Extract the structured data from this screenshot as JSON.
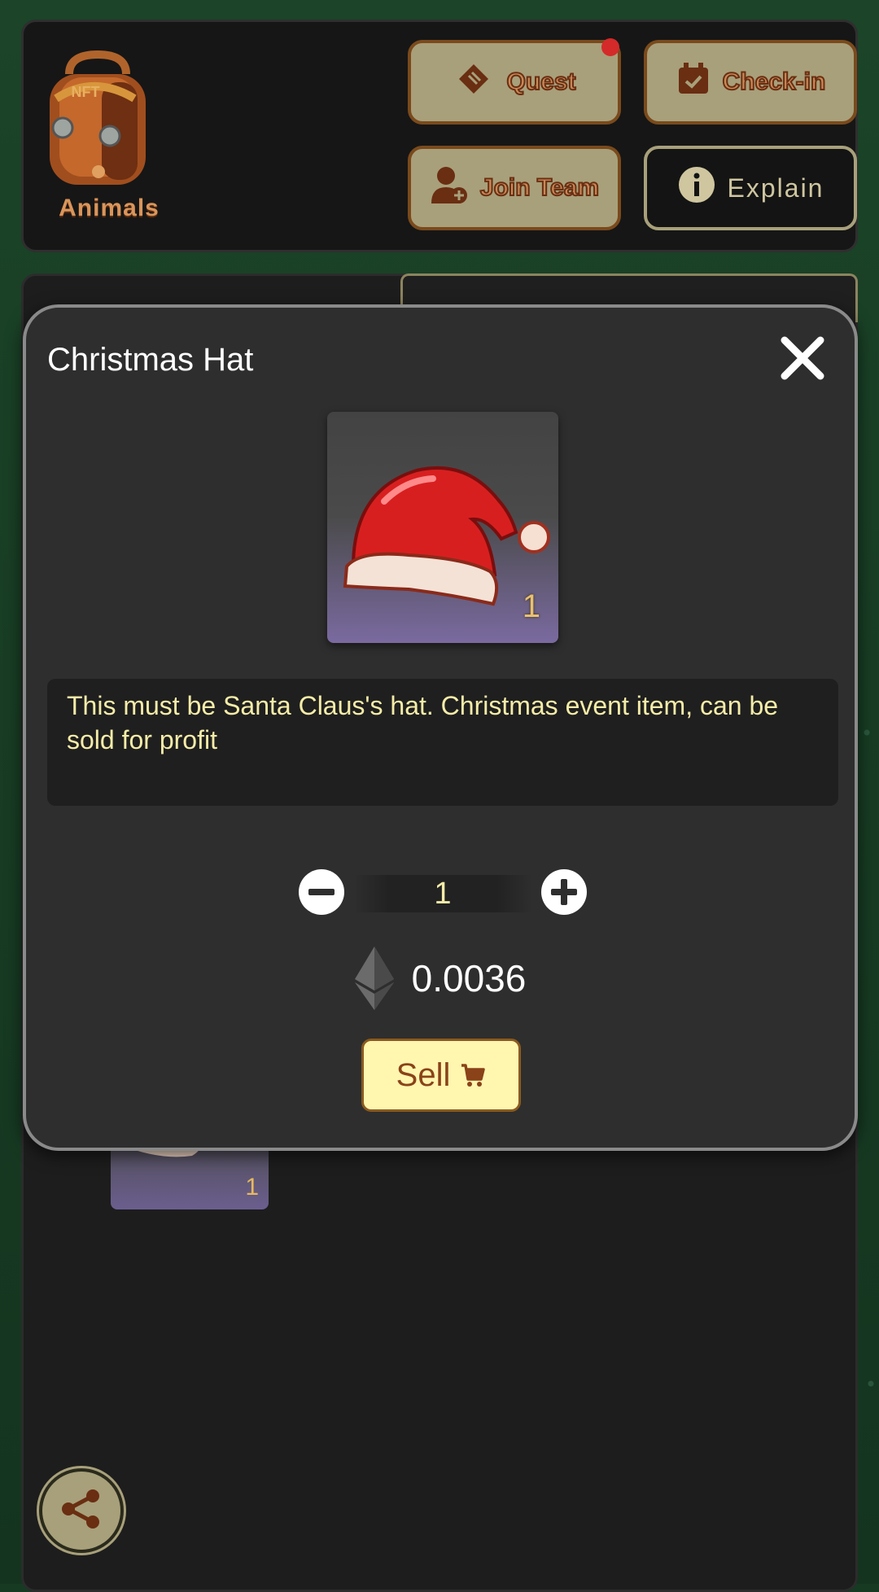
{
  "header": {
    "backpack_label": "Animals",
    "backpack_badge": "NFT",
    "quest_label": "Quest",
    "checkin_label": "Check-in",
    "join_team_label": "Join Team",
    "explain_label": "Explain"
  },
  "modal": {
    "title": "Christmas Hat",
    "item_count": "1",
    "description": "This must be Santa Claus's hat. Christmas event item, can be sold for profit",
    "quantity": "1",
    "price": "0.0036",
    "sell_label": "Sell"
  },
  "background": {
    "item_count": "1"
  },
  "colors": {
    "accent_gold": "#a8a07a",
    "brown": "#6a2e12",
    "desc_text": "#f5eca8",
    "sell_bg": "#fff6b0"
  }
}
